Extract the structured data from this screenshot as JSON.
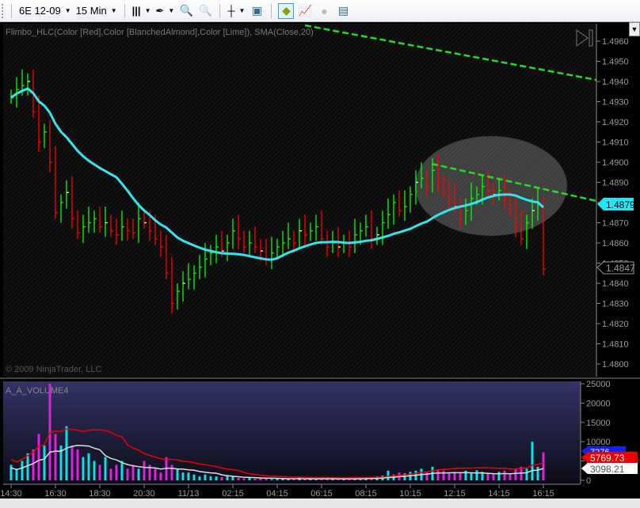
{
  "toolbar": {
    "instrument": "6E 12-09",
    "interval": "15 Min"
  },
  "indicator_label": "Flimbo_HLC(Color [Red],Color [BlanchedAlmond],Color [Lime]), SMA(Close,20)",
  "copyright": "© 2009 NinjaTrader, LLC",
  "volume_label": "A_A_VOLUME4",
  "price_axis": [
    "1.4960",
    "1.4950",
    "1.4940",
    "1.4930",
    "1.4920",
    "1.4910",
    "1.4900",
    "1.4890",
    "1.4880",
    "1.4870",
    "1.4860",
    "1.4850",
    "1.4840",
    "1.4830",
    "1.4820",
    "1.4810",
    "1.4800"
  ],
  "price_markers": {
    "sma": "1.4879",
    "last": "1.4847"
  },
  "volume_axis": [
    "25000",
    "20000",
    "15000",
    "10000",
    "5000",
    "0"
  ],
  "volume_markers": {
    "blue": "7276",
    "red": "5769.73",
    "white": "3098.21"
  },
  "time_axis": [
    "14:30",
    "16:30",
    "18:30",
    "20:30",
    "11/13",
    "02:15",
    "04:15",
    "06:15",
    "08:15",
    "10:15",
    "12:15",
    "14:15",
    "16:15"
  ],
  "colors": {
    "up": "#00ff00",
    "down": "#ff0000",
    "sma": "#33e5f0",
    "trend": "#22dd22",
    "vol_up": "#00e5ee",
    "vol_down": "#e020e0"
  },
  "chart_data": {
    "type": "bar",
    "closes": [
      1.4932,
      1.4936,
      1.4938,
      1.494,
      1.4925,
      1.491,
      1.4915,
      1.49,
      1.4875,
      1.488,
      1.4885,
      1.4872,
      1.4865,
      1.4868,
      1.487,
      1.4872,
      1.4868,
      1.487,
      1.4866,
      1.4864,
      1.4868,
      1.4866,
      1.4865,
      1.4872,
      1.487,
      1.4866,
      1.4862,
      1.4858,
      1.4845,
      1.483,
      1.4836,
      1.484,
      1.4842,
      1.4845,
      1.4848,
      1.4852,
      1.4855,
      1.4858,
      1.4856,
      1.486,
      1.4866,
      1.4862,
      1.4858,
      1.486,
      1.4858,
      1.4856,
      1.4852,
      1.4855,
      1.4858,
      1.486,
      1.4862,
      1.486,
      1.4866,
      1.4864,
      1.4866,
      1.4868,
      1.4862,
      1.4858,
      1.486,
      1.4858,
      1.486,
      1.4858,
      1.4864,
      1.4866,
      1.4868,
      1.4862,
      1.4864,
      1.487,
      1.4874,
      1.488,
      1.4876,
      1.4878,
      1.4884,
      1.489,
      1.4892,
      1.4888,
      1.4896,
      1.489,
      1.4885,
      1.4882,
      1.4878,
      1.4872,
      1.4876,
      1.4882,
      1.4884,
      1.4888,
      1.4886,
      1.4884,
      1.4886,
      1.4882,
      1.4876,
      1.4868,
      1.4862,
      1.487,
      1.4876,
      1.4879,
      1.4847
    ],
    "volumes": [
      4000,
      3000,
      5000,
      7000,
      8000,
      12000,
      9000,
      25000,
      12000,
      9000,
      14000,
      9000,
      8000,
      6000,
      7000,
      5000,
      4000,
      6000,
      3000,
      4000,
      5000,
      3000,
      4000,
      3000,
      5000,
      4000,
      3000,
      2000,
      6000,
      4000,
      3000,
      2000,
      2000,
      1500,
      1000,
      1500,
      1000,
      1000,
      800,
      1200,
      1000,
      600,
      500,
      700,
      400,
      600,
      500,
      300,
      500,
      600,
      400,
      500,
      700,
      400,
      500,
      300,
      600,
      400,
      500,
      300,
      400,
      500,
      600,
      800,
      700,
      900,
      1000,
      1200,
      2500,
      1500,
      2000,
      1800,
      2200,
      2500,
      3000,
      2000,
      3500,
      2800,
      2500,
      2000,
      2200,
      1800,
      2500,
      2000,
      2600,
      2200,
      2000,
      1800,
      2200,
      2500,
      1500,
      3000,
      3500,
      3000,
      10000,
      3500,
      7276
    ],
    "ylim": [
      1.4795,
      1.4965
    ],
    "sma_period": 20
  }
}
